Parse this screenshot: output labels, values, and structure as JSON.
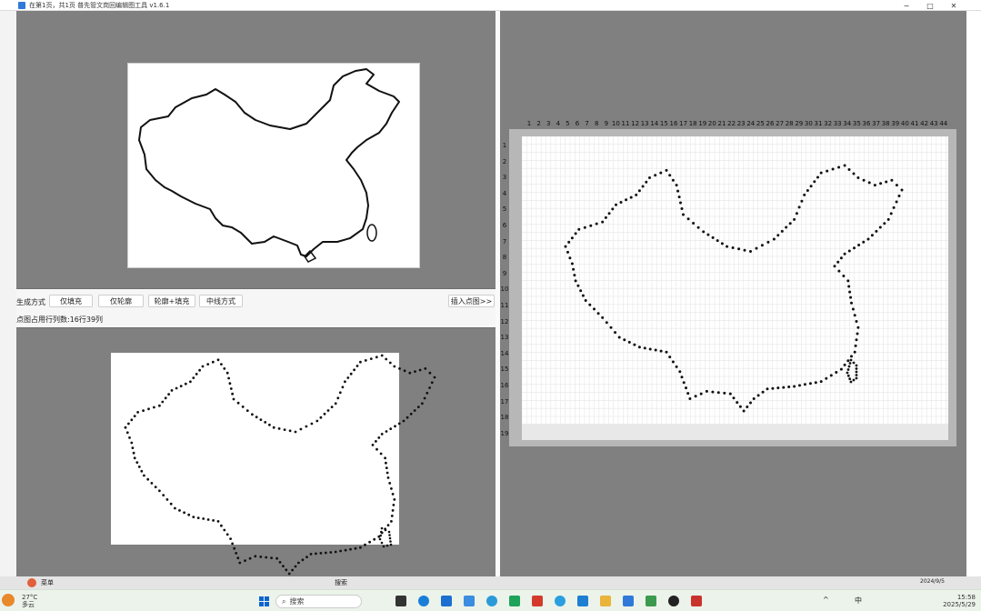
{
  "window": {
    "title": "在第1页，共1页 普先管文岗回编辑图工具 v1.6.1",
    "controls": {
      "minimize": "−",
      "maximize": "□",
      "close": "✕"
    }
  },
  "toolbar": {
    "mode_label": "生成方式",
    "buttons": [
      "仅填充",
      "仅轮廓",
      "轮廓+填充",
      "中线方式"
    ],
    "insert_button": "插入点图>>",
    "stats": "点图占用行列数:16行39列"
  },
  "grid": {
    "columns": [
      "1",
      "2",
      "3",
      "4",
      "5",
      "6",
      "7",
      "8",
      "9",
      "10",
      "11",
      "12",
      "13",
      "14",
      "15",
      "16",
      "17",
      "18",
      "19",
      "20",
      "21",
      "22",
      "23",
      "24",
      "25",
      "26",
      "27",
      "28",
      "29",
      "30",
      "31",
      "32",
      "33",
      "34",
      "35",
      "36",
      "37",
      "38",
      "39",
      "40",
      "41",
      "42",
      "43",
      "44"
    ],
    "rows": [
      "1",
      "2",
      "3",
      "4",
      "5",
      "6",
      "7",
      "8",
      "9",
      "10",
      "11",
      "12",
      "13",
      "14",
      "15",
      "16",
      "17",
      "18",
      "19"
    ]
  },
  "under_bar": {
    "left_text": "菜单",
    "search_text": "搜索",
    "right_text": "2024/9/5"
  },
  "taskbar": {
    "weather_temp": "27°C",
    "weather_desc": "多云",
    "search_placeholder": "搜索",
    "ime": "中",
    "time": "15:58",
    "date": "2025/5/29"
  },
  "colors": {
    "pane_gray": "#808080",
    "accent": "#0a64d0"
  }
}
